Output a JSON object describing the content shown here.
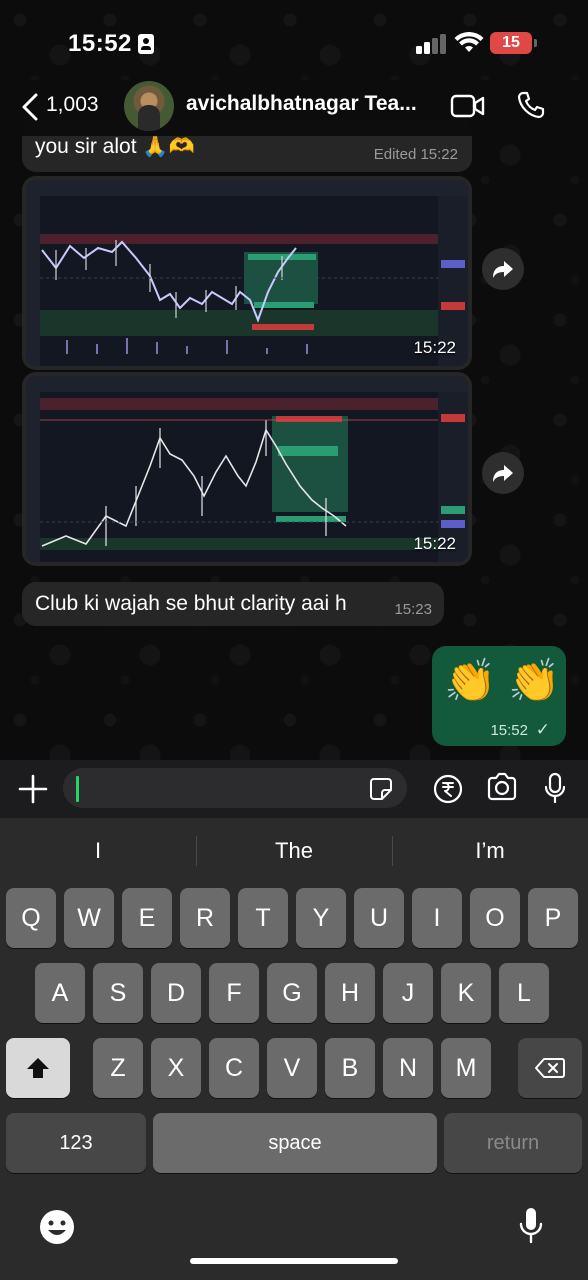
{
  "status_bar": {
    "time": "15:52",
    "battery": "15"
  },
  "header": {
    "back_count": "1,003",
    "name": "avichalbhatnagar Tea..."
  },
  "messages": {
    "first": {
      "text": "you sir alot 🙏🫶",
      "time": "Edited 15:22"
    },
    "image1": {
      "time": "15:22"
    },
    "image2": {
      "time": "15:22"
    },
    "second": {
      "text": "Club ki wajah se bhut clarity aai h",
      "time": "15:23"
    },
    "outgoing": {
      "emoji": "👏 👏",
      "time": "15:52",
      "status": "✓"
    }
  },
  "input": {
    "value": ""
  },
  "keyboard": {
    "suggestions": [
      "I",
      "The",
      "I’m"
    ],
    "row1": [
      "Q",
      "W",
      "E",
      "R",
      "T",
      "Y",
      "U",
      "I",
      "O",
      "P"
    ],
    "row2": [
      "A",
      "S",
      "D",
      "F",
      "G",
      "H",
      "J",
      "K",
      "L"
    ],
    "row3": [
      "Z",
      "X",
      "C",
      "V",
      "B",
      "N",
      "M"
    ],
    "numbers": "123",
    "space": "space",
    "return": "return"
  },
  "colors": {
    "outgoing_bubble": "#125a3b",
    "incoming_bubble": "#262626",
    "accent": "#25d366",
    "battery": "#e04848"
  },
  "icons": [
    "back-chevron",
    "video-call",
    "phone-call",
    "forward",
    "plus",
    "sticker",
    "rupee",
    "camera",
    "microphone",
    "shift",
    "backspace",
    "emoji",
    "dictation"
  ]
}
